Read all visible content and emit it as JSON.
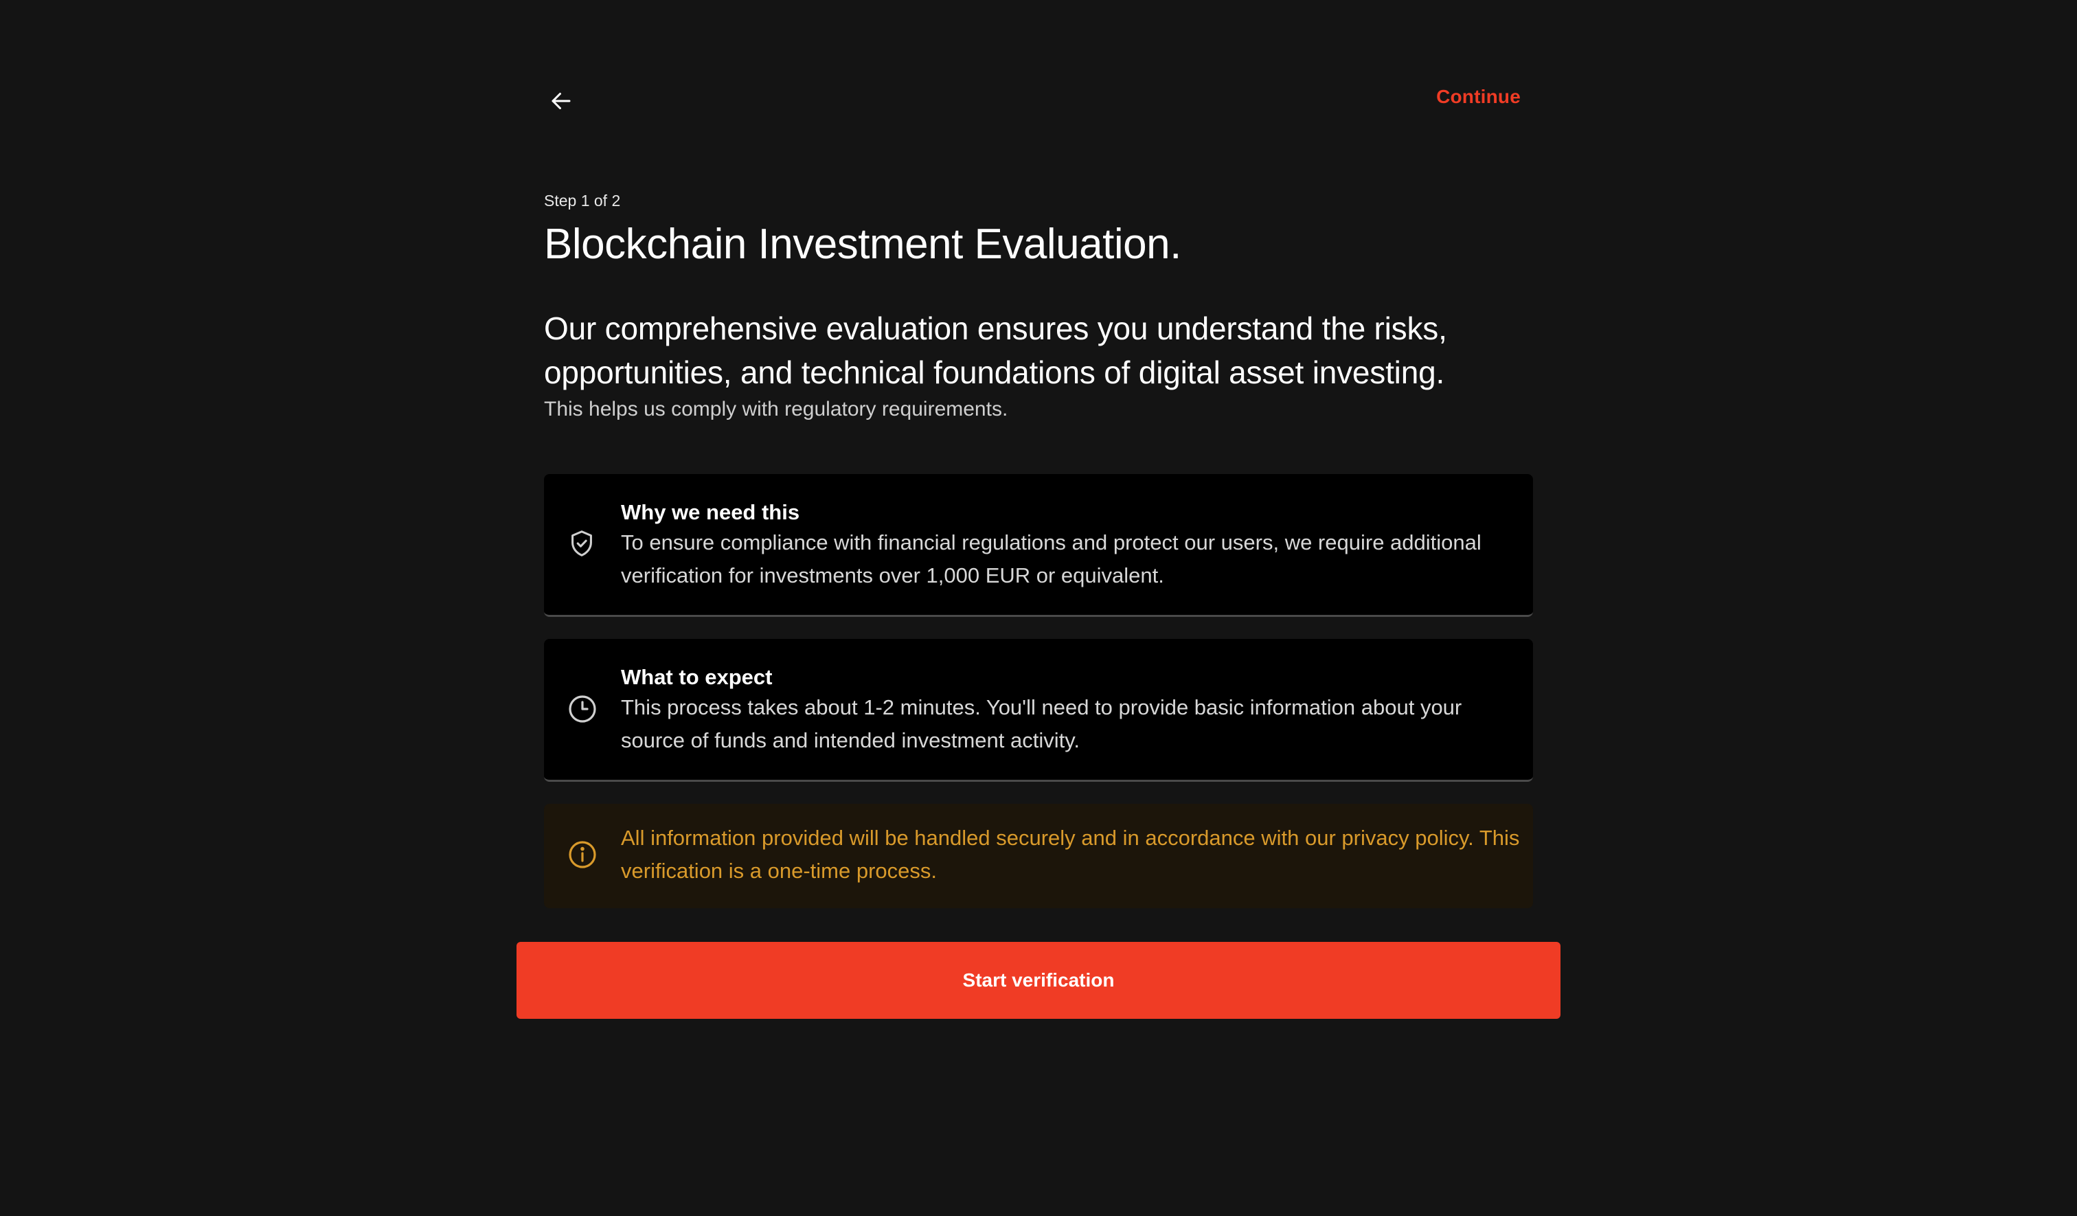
{
  "header": {
    "back_icon": "arrow-left-icon",
    "continue_label": "Continue"
  },
  "intro": {
    "step": "Step 1 of 2",
    "title": "Blockchain Investment Evaluation.",
    "lead": "Our comprehensive evaluation ensures you understand the risks, opportunities, and technical foundations of digital asset investing.",
    "sub": "This helps us comply with regulatory requirements."
  },
  "cards": [
    {
      "icon": "shield-check-icon",
      "title": "Why we need this",
      "body": "To ensure compliance with financial regulations and protect our users, we require additional verification for investments over 1,000 EUR or equivalent."
    },
    {
      "icon": "clock-icon",
      "title": "What to expect",
      "body": "This process takes about 1-2 minutes. You'll need to provide basic information about your source of funds and intended investment activity."
    }
  ],
  "notice": {
    "icon": "info-icon",
    "text": "All information provided will be handled securely and in accordance with our privacy policy. This verification is a one-time process."
  },
  "cta": {
    "label": "Start verification"
  },
  "colors": {
    "background": "#141414",
    "accent": "#f03c25",
    "card_bg": "#000000",
    "notice_bg": "#1c150a",
    "notice_text": "#d99a2b"
  }
}
